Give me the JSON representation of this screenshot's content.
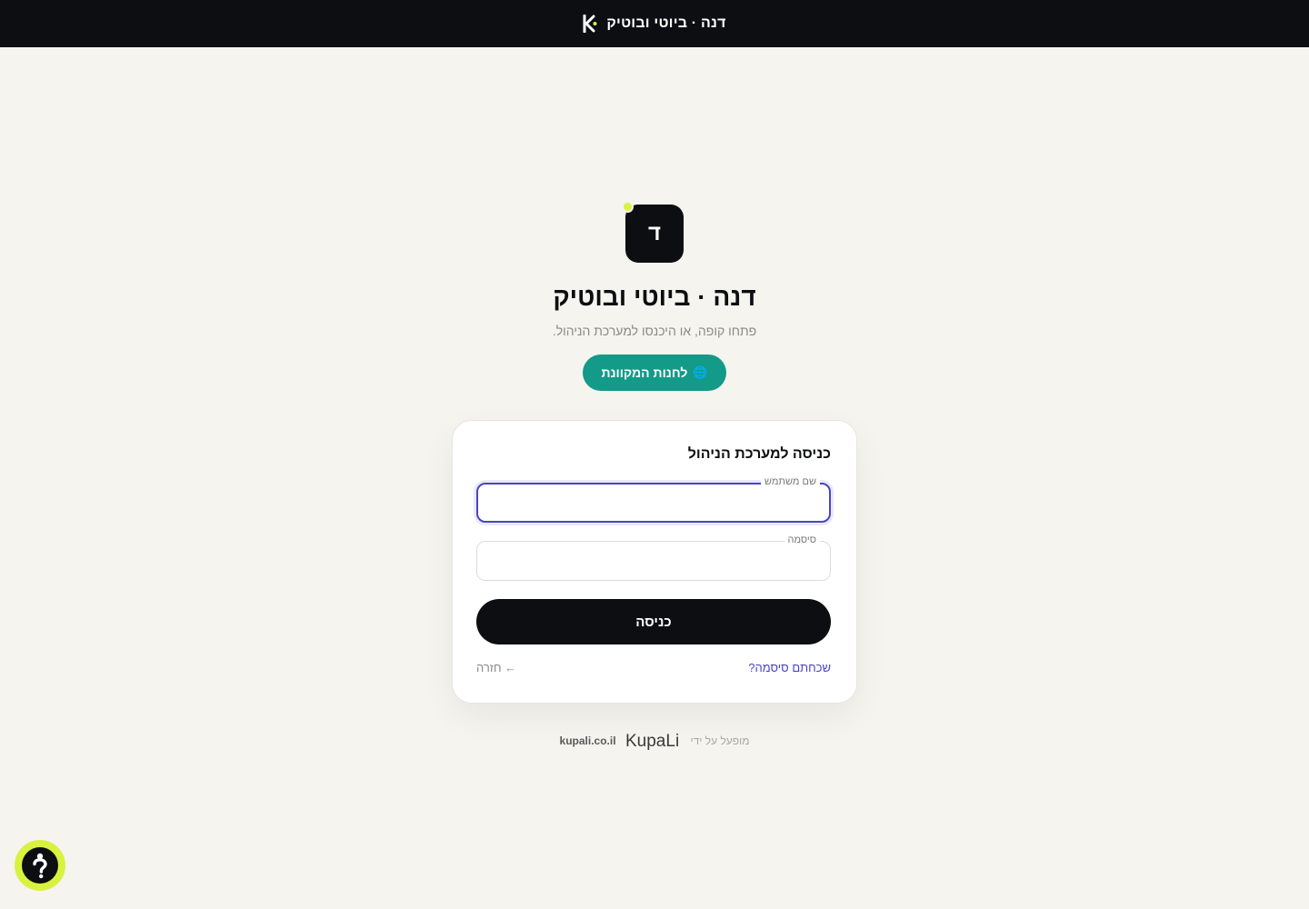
{
  "topbar": {
    "brand_name": "דנה · ביוטי ובוטיק",
    "brand_icon": "kupali-k-logo-icon"
  },
  "store": {
    "initial": "ד",
    "title": "דנה · ביוטי ובוטיק",
    "subtitle": "פתחו קופה, או היכנסו למערכת הניהול.",
    "shop_link_label": "לחנות המקוונת",
    "shop_link_icon": "globe-icon"
  },
  "login": {
    "title": "כניסה למערכת הניהול",
    "username_label": "שם משתמש",
    "username_value": "",
    "password_label": "סיסמה",
    "password_value": "",
    "submit_label": "כניסה",
    "forgot_label": "שכחתם סיסמה?",
    "back_label": "← חזרה"
  },
  "footer": {
    "powered_by": "מופעל על ידי",
    "brand_wordmark": "KupaLi",
    "domain": "kupali.co.il"
  },
  "help": {
    "icon": "question-icon"
  },
  "colors": {
    "dark": "#0d0e11",
    "accent_lime": "#d9f23f",
    "teal": "#139a88",
    "focus": "#4a44c6",
    "background": "#f5f4ef"
  }
}
